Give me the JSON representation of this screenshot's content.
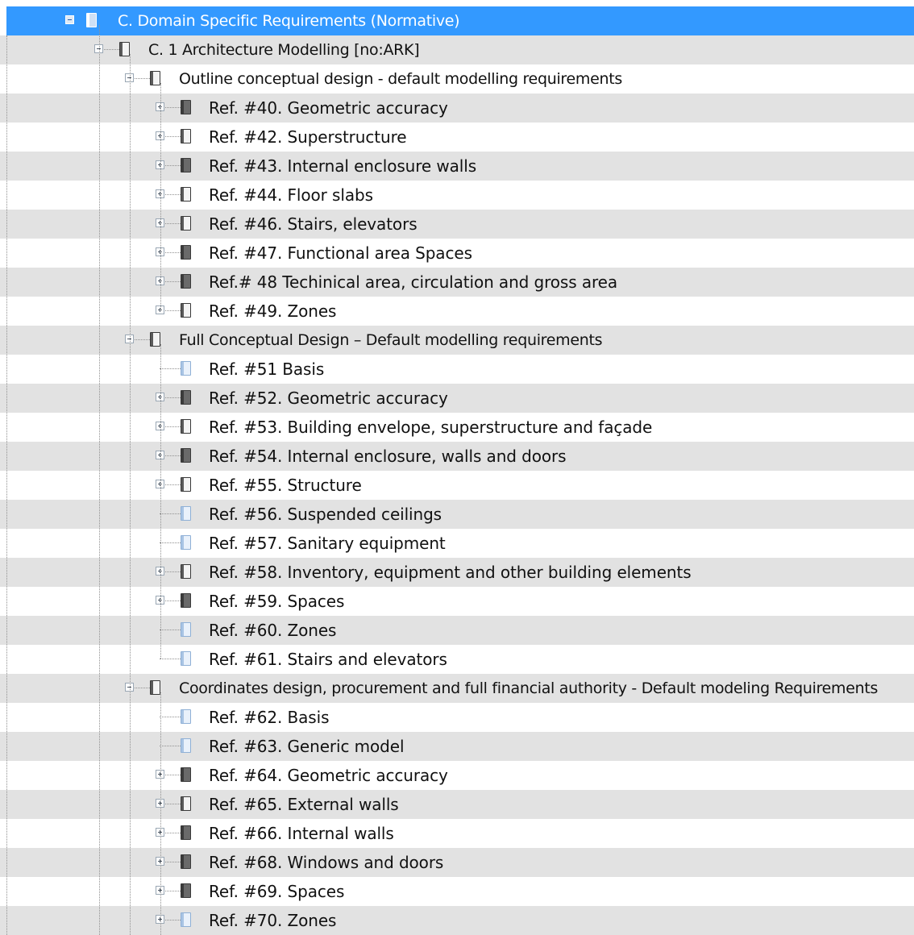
{
  "tree": {
    "rows": [
      {
        "label": "C. Domain Specific Requirements (Normative)",
        "level": 0,
        "toggle": "minus",
        "icon": "document-icon",
        "selected": true
      },
      {
        "label": "C. 1 Architecture Modelling [no:ARK]",
        "level": 1,
        "toggle": "minus",
        "icon": "document-icon"
      },
      {
        "label": "Outline conceptual design - default modelling requirements",
        "level": 2,
        "toggle": "minus",
        "icon": "document-icon"
      },
      {
        "label": "Ref. #40. Geometric accuracy",
        "level": 3,
        "toggle": "plus",
        "icon": "document-dark-icon"
      },
      {
        "label": "Ref. #42. Superstructure",
        "level": 3,
        "toggle": "plus",
        "icon": "document-icon"
      },
      {
        "label": "Ref. #43. Internal enclosure walls",
        "level": 3,
        "toggle": "plus",
        "icon": "document-dark-icon"
      },
      {
        "label": "Ref. #44. Floor slabs",
        "level": 3,
        "toggle": "plus",
        "icon": "document-icon"
      },
      {
        "label": "Ref. #46. Stairs, elevators",
        "level": 3,
        "toggle": "plus",
        "icon": "document-icon"
      },
      {
        "label": "Ref. #47. Functional area Spaces",
        "level": 3,
        "toggle": "plus",
        "icon": "document-dark-icon"
      },
      {
        "label": "Ref.# 48 Techinical area, circulation and gross area",
        "level": 3,
        "toggle": "plus",
        "icon": "document-dark-icon"
      },
      {
        "label": "Ref. #49. Zones",
        "level": 3,
        "toggle": "plus",
        "icon": "document-icon"
      },
      {
        "label": "Full Conceptual Design – Default modelling requirements",
        "level": 2,
        "toggle": "minus",
        "icon": "document-icon"
      },
      {
        "label": "Ref. #51 Basis",
        "level": 3,
        "toggle": "none",
        "icon": "document-light-icon"
      },
      {
        "label": "Ref. #52. Geometric accuracy",
        "level": 3,
        "toggle": "plus",
        "icon": "document-dark-icon"
      },
      {
        "label": "Ref. #53. Building envelope, superstructure and façade",
        "level": 3,
        "toggle": "plus",
        "icon": "document-icon"
      },
      {
        "label": "Ref. #54. Internal enclosure, walls and doors",
        "level": 3,
        "toggle": "plus",
        "icon": "document-dark-icon"
      },
      {
        "label": "Ref. #55. Structure",
        "level": 3,
        "toggle": "plus",
        "icon": "document-icon"
      },
      {
        "label": "Ref. #56. Suspended ceilings",
        "level": 3,
        "toggle": "none",
        "icon": "document-light-icon"
      },
      {
        "label": "Ref. #57. Sanitary equipment",
        "level": 3,
        "toggle": "none",
        "icon": "document-light-icon"
      },
      {
        "label": "Ref. #58. Inventory, equipment and other building elements",
        "level": 3,
        "toggle": "plus",
        "icon": "document-icon"
      },
      {
        "label": "Ref. #59. Spaces",
        "level": 3,
        "toggle": "plus",
        "icon": "document-dark-icon"
      },
      {
        "label": "Ref. #60. Zones",
        "level": 3,
        "toggle": "none",
        "icon": "document-light-icon"
      },
      {
        "label": "Ref. #61. Stairs and elevators",
        "level": 3,
        "toggle": "none",
        "icon": "document-light-icon"
      },
      {
        "label": "Coordinates design, procurement and full financial authority - Default modeling Requirements",
        "level": 2,
        "toggle": "minus",
        "icon": "document-icon"
      },
      {
        "label": "Ref. #62. Basis",
        "level": 3,
        "toggle": "none",
        "icon": "document-light-icon"
      },
      {
        "label": "Ref. #63. Generic model",
        "level": 3,
        "toggle": "none",
        "icon": "document-light-icon"
      },
      {
        "label": "Ref. #64. Geometric accuracy",
        "level": 3,
        "toggle": "plus",
        "icon": "document-dark-icon"
      },
      {
        "label": "Ref. #65. External walls",
        "level": 3,
        "toggle": "plus",
        "icon": "document-icon"
      },
      {
        "label": "Ref. #66. Internal walls",
        "level": 3,
        "toggle": "plus",
        "icon": "document-dark-icon"
      },
      {
        "label": "Ref. #68. Windows and doors",
        "level": 3,
        "toggle": "plus",
        "icon": "document-dark-icon"
      },
      {
        "label": "Ref. #69. Spaces",
        "level": 3,
        "toggle": "plus",
        "icon": "document-dark-icon"
      },
      {
        "label": "Ref. #70. Zones",
        "level": 3,
        "toggle": "plus",
        "icon": "document-light-icon"
      }
    ]
  },
  "colors": {
    "selection": "#3399ff",
    "alternate_row": "#e2e2e2",
    "background": "#ffffff"
  }
}
